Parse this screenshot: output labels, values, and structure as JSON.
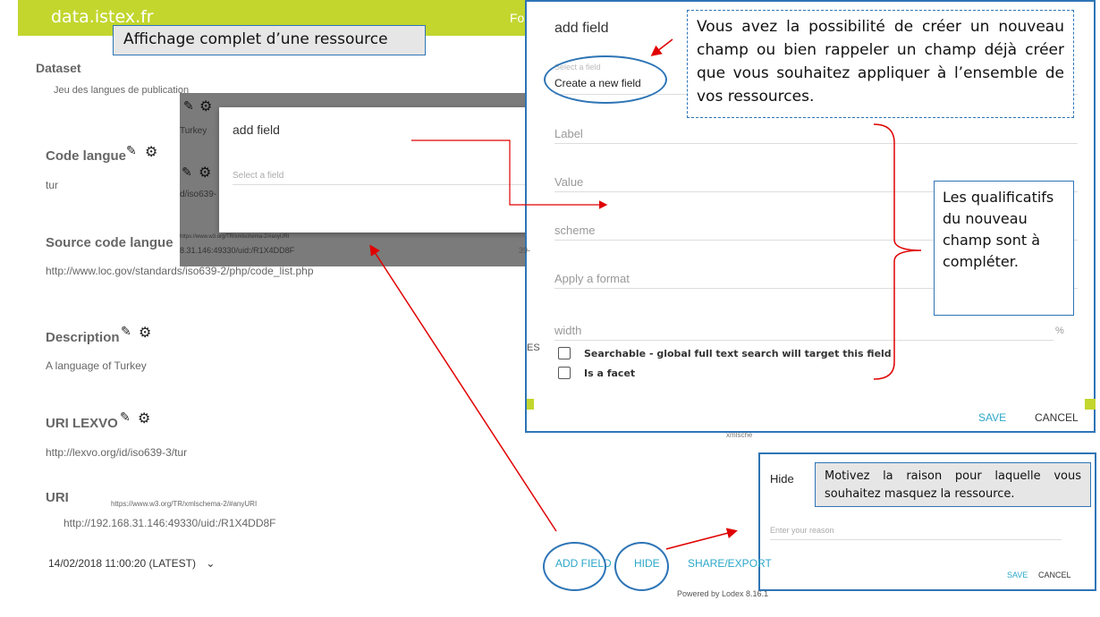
{
  "app": {
    "brand": "data.istex.fr",
    "nav_item": "Formu"
  },
  "callouts": {
    "title": "Affichage complet d’une ressource",
    "new_field": "Vous avez la possibilité de créer un nouveau champ ou bien rappeler un champ déjà créer que vous souhaitez appliquer à l’ensemble de vos ressources.",
    "qualifiers": "Les qualificatifs du nouveau champ sont à compléter.",
    "hide_reason": "Motivez la raison pour laquelle vous souhaitez masquez la ressource."
  },
  "resource": {
    "dataset_label": "Dataset",
    "dataset_value": "Jeu des langues de publication",
    "fields": [
      {
        "label": "Code langue",
        "value": "tur"
      },
      {
        "label": "Source code langue",
        "value": "http://www.loc.gov/standards/iso639-2/php/code_list.php"
      },
      {
        "label": "Description",
        "value": "A language of Turkey"
      },
      {
        "label": "URI LEXVO",
        "value": "http://lexvo.org/id/iso639-3/tur"
      }
    ],
    "uri_label": "URI",
    "uri_scheme": "https://www.w3.org/TR/xmlschema-2/#anyURI",
    "uri_value": "http://192.168.31.146:49330/uid:/R1X4DD8F",
    "version": "14/02/2018 11:00:20 (LATEST)"
  },
  "small_dialog": {
    "title": "add field",
    "select_placeholder": "Select a field",
    "behind_texts": [
      "Turkey",
      "d/iso639-",
      "https://www.w3.org/TR/xmlschema-2/#anyURI",
      "8.31.146:49330/uid:/R1X4DD8F"
    ]
  },
  "main_dialog": {
    "title": "add field",
    "select_label": "Select a field",
    "select_value": "Create a new field",
    "fields": {
      "label": "Label",
      "value": "Value",
      "scheme": "scheme",
      "format": "Apply a format",
      "width": "width"
    },
    "width_unit": "%",
    "checkbox_searchable": "Searchable - global full text search will target this field",
    "checkbox_facet": "Is a facet",
    "save": "SAVE",
    "cancel": "CANCEL"
  },
  "hide_dialog": {
    "title": "Hide",
    "placeholder": "Enter your reason",
    "save": "SAVE",
    "cancel": "CANCEL"
  },
  "actions": {
    "add_field": "ADD FIELD",
    "hide": "HIDE",
    "share_export": "SHARE/EXPORT"
  },
  "footer": {
    "powered": "Powered by Lodex 8.16.1"
  },
  "colors": {
    "accent": "#c2d62e",
    "link": "#2ba7c9",
    "annotation_blue": "#2e75b6",
    "arrow_red": "#e00000"
  }
}
